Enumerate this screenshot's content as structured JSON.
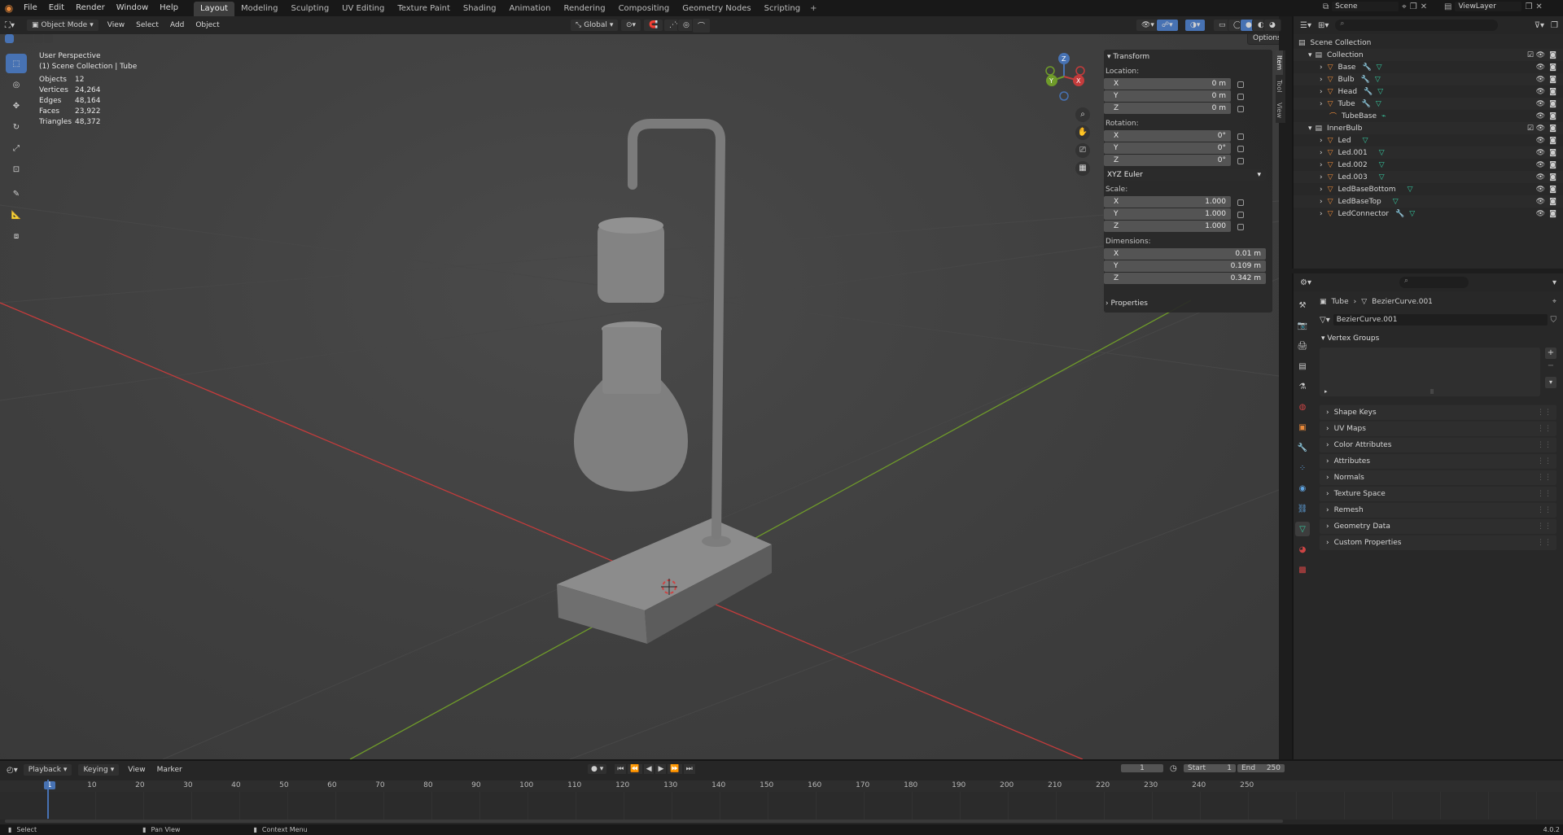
{
  "menu": {
    "file": "File",
    "edit": "Edit",
    "render": "Render",
    "window": "Window",
    "help": "Help"
  },
  "workspaces": [
    "Layout",
    "Modeling",
    "Sculpting",
    "UV Editing",
    "Texture Paint",
    "Shading",
    "Animation",
    "Rendering",
    "Compositing",
    "Geometry Nodes",
    "Scripting"
  ],
  "scene": "Scene",
  "view_layer": "ViewLayer",
  "viewport_header": {
    "mode": "Object Mode",
    "view": "View",
    "select": "Select",
    "add": "Add",
    "object": "Object",
    "transform_orientation": "Global",
    "options": "Options"
  },
  "overlay_info": {
    "perspective": "User Perspective",
    "collection": "(1) Scene Collection | Tube",
    "stats": [
      {
        "label": "Objects",
        "value": "12"
      },
      {
        "label": "Vertices",
        "value": "24,264"
      },
      {
        "label": "Edges",
        "value": "48,164"
      },
      {
        "label": "Faces",
        "value": "23,922"
      },
      {
        "label": "Triangles",
        "value": "48,372"
      }
    ]
  },
  "transform_panel": {
    "title": "Transform",
    "location_label": "Location:",
    "location": [
      {
        "axis": "X",
        "value": "0 m"
      },
      {
        "axis": "Y",
        "value": "0 m"
      },
      {
        "axis": "Z",
        "value": "0 m"
      }
    ],
    "rotation_label": "Rotation:",
    "rotation": [
      {
        "axis": "X",
        "value": "0°"
      },
      {
        "axis": "Y",
        "value": "0°"
      },
      {
        "axis": "Z",
        "value": "0°"
      }
    ],
    "rotation_mode": "XYZ Euler",
    "scale_label": "Scale:",
    "scale": [
      {
        "axis": "X",
        "value": "1.000"
      },
      {
        "axis": "Y",
        "value": "1.000"
      },
      {
        "axis": "Z",
        "value": "1.000"
      }
    ],
    "dimensions_label": "Dimensions:",
    "dimensions": [
      {
        "axis": "X",
        "value": "0.01 m"
      },
      {
        "axis": "Y",
        "value": "0.109 m"
      },
      {
        "axis": "Z",
        "value": "0.342 m"
      }
    ],
    "properties_label": "Properties"
  },
  "side_tabs": [
    "Item",
    "Tool",
    "View"
  ],
  "outliner": {
    "root": "Scene Collection",
    "collections": [
      {
        "name": "Collection",
        "items": [
          "Base",
          "Bulb",
          "Head",
          "Tube",
          "TubeBase"
        ]
      },
      {
        "name": "InnerBulb",
        "items": [
          "Led",
          "Led.001",
          "Led.002",
          "Led.003",
          "LedBaseBottom",
          "LedBaseTop",
          "LedConnector"
        ]
      }
    ]
  },
  "properties": {
    "breadcrumb_object": "Tube",
    "breadcrumb_data": "BezierCurve.001",
    "data_name": "BezierCurve.001",
    "vertex_groups": "Vertex Groups",
    "panels": [
      "Shape Keys",
      "UV Maps",
      "Color Attributes",
      "Attributes",
      "Normals",
      "Texture Space",
      "Remesh",
      "Geometry Data",
      "Custom Properties"
    ]
  },
  "timeline": {
    "playback": "Playback",
    "keying": "Keying",
    "view": "View",
    "marker": "Marker",
    "current_frame": "1",
    "start_label": "Start",
    "start": "1",
    "end_label": "End",
    "end": "250",
    "ticks": [
      "1",
      "10",
      "20",
      "30",
      "40",
      "50",
      "60",
      "70",
      "80",
      "90",
      "100",
      "110",
      "120",
      "130",
      "140",
      "150",
      "160",
      "170",
      "180",
      "190",
      "200",
      "210",
      "220",
      "230",
      "240",
      "250"
    ]
  },
  "statusbar": {
    "select": "Select",
    "pan": "Pan View",
    "context": "Context Menu",
    "version": "4.0.2"
  },
  "colors": {
    "accent": "#4772b3",
    "x_axis": "#c43c3c",
    "y_axis": "#6f9b2a",
    "mesh_icon": "#36c9a0",
    "object_icon": "#e8893a"
  }
}
